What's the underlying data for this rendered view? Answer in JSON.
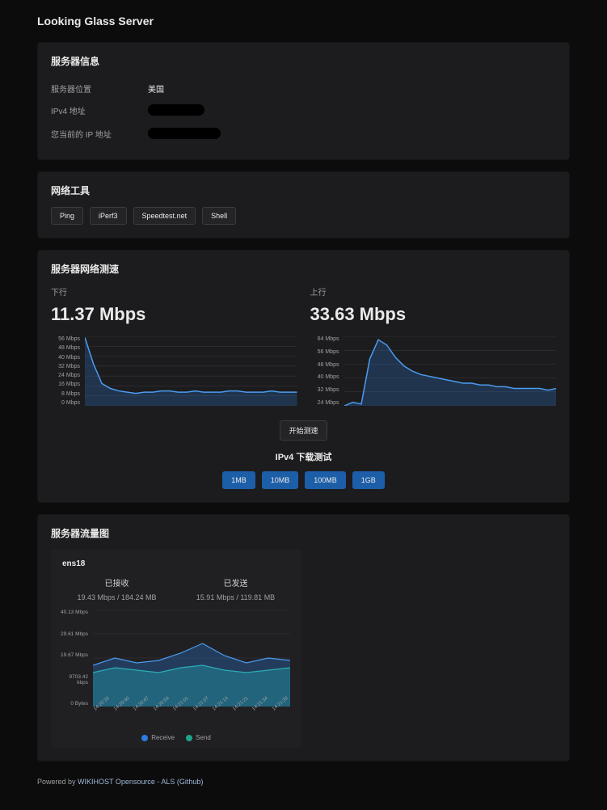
{
  "title": "Looking Glass Server",
  "server_info": {
    "heading": "服务器信息",
    "rows": [
      {
        "label": "服务器位置",
        "value": "美国"
      },
      {
        "label": "IPv4 地址",
        "value": ""
      },
      {
        "label": "您当前的 IP 地址",
        "value": ""
      }
    ]
  },
  "tools": {
    "heading": "网络工具",
    "items": [
      "Ping",
      "iPerf3",
      "Speedtest.net",
      "Shell"
    ]
  },
  "speedtest": {
    "heading": "服务器网络测速",
    "download": {
      "label": "下行",
      "value": "11.37 Mbps"
    },
    "upload": {
      "label": "上行",
      "value": "33.63 Mbps"
    },
    "start_btn": "开始测速",
    "dl_title": "IPv4 下载测试",
    "dl_sizes": [
      "1MB",
      "10MB",
      "100MB",
      "1GB"
    ]
  },
  "flow": {
    "heading": "服务器流量图",
    "iface": "ens18",
    "rx": {
      "title": "已接收",
      "summary": "19.43 Mbps / 184.24 MB"
    },
    "tx": {
      "title": "已发送",
      "summary": "15.91 Mbps / 119.81 MB"
    },
    "legend_rx": "Receive",
    "legend_tx": "Send"
  },
  "footer": {
    "prefix": "Powered by ",
    "brand": "WIKIHOST Opensource",
    "sep": " - ",
    "repo": "ALS (Github)"
  },
  "chart_data": [
    {
      "id": "dl_chart",
      "type": "line",
      "x_unit": "sample",
      "ylabel": "Mbps",
      "ylim": [
        0,
        56
      ],
      "yticks": [
        "56 Mbps",
        "48 Mbps",
        "40 Mbps",
        "32 Mbps",
        "24 Mbps",
        "16 Mbps",
        "8 Mbps",
        "0 Mbps"
      ],
      "series": [
        {
          "name": "download",
          "values": [
            55,
            34,
            18,
            14,
            12,
            11,
            10,
            11,
            11,
            12,
            12,
            11,
            11,
            12,
            11,
            11,
            11,
            12,
            12,
            11,
            11,
            11,
            12,
            11,
            11,
            11
          ]
        }
      ]
    },
    {
      "id": "ul_chart",
      "type": "line",
      "x_unit": "sample",
      "ylabel": "Mbps",
      "ylim": [
        24,
        64
      ],
      "yticks": [
        "64 Mbps",
        "56 Mbps",
        "48 Mbps",
        "40 Mbps",
        "32 Mbps",
        "24 Mbps"
      ],
      "series": [
        {
          "name": "upload",
          "values": [
            24,
            26,
            25,
            51,
            62,
            59,
            52,
            47,
            44,
            42,
            41,
            40,
            39,
            38,
            37,
            37,
            36,
            36,
            35,
            35,
            34,
            34,
            34,
            34,
            33,
            34
          ]
        }
      ]
    },
    {
      "id": "flow_chart",
      "type": "area",
      "title": "ens18",
      "ylabel": "throughput",
      "ylim": [
        0,
        40
      ],
      "yticks": [
        "40.13 Mbps",
        "29.61 Mbps",
        "19.67 Mbps",
        "9703.42 kbps",
        "0 Bytes"
      ],
      "x": [
        "14:20:33",
        "14:20:40",
        "14:20:47",
        "14:20:54",
        "14:21:01",
        "14:21:07",
        "14:21:14",
        "14:21:21",
        "14:21:34",
        "14:21:39"
      ],
      "series": [
        {
          "name": "Receive",
          "values": [
            17,
            20,
            18,
            19,
            22,
            26,
            21,
            18,
            20,
            19
          ]
        },
        {
          "name": "Send",
          "values": [
            14,
            16,
            15,
            14,
            16,
            17,
            15,
            14,
            15,
            16
          ]
        }
      ]
    }
  ]
}
